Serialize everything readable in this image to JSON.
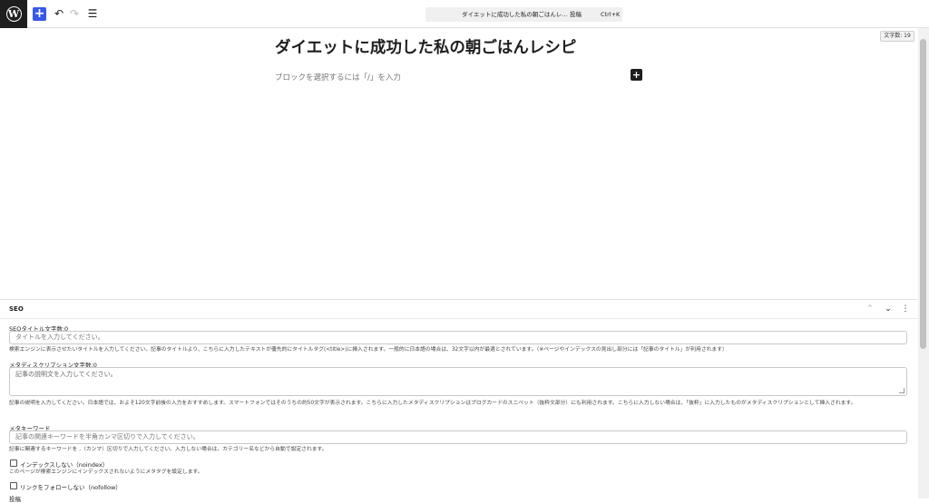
{
  "toolbar": {
    "logo_letter": "W",
    "add_label": "+",
    "undo_icon": "↶",
    "redo_icon": "↷",
    "list_icon": "☰",
    "command_bar": {
      "title": "ダイエットに成功した私の朝ごはんレ…",
      "type": "投稿",
      "shortcut": "Ctrl+K"
    }
  },
  "editor": {
    "post_title": "ダイエットに成功した私の朝ごはんレシピ",
    "block_placeholder": "ブロックを選択するには「/」を入力",
    "inline_add": "+",
    "char_count": "文字数: 19"
  },
  "seo": {
    "heading": "SEO",
    "collapse_up": "⌃",
    "collapse_down": "⌄",
    "more": "⋮",
    "title_field": {
      "label": "SEOタイトル文字数:0",
      "placeholder": "タイトルを入力してください。",
      "help": "検索エンジンに表示させたいタイトルを入力してください。記事のタイトルより、こちらに入力したテキストが優先的にタイトルタグ(<title>)に挿入されます。一般的に日本語の場合は、32文字以内が最適とされています。（※ページやインデックスの見出し部分には「記事のタイトル」が利用されます）"
    },
    "description_field": {
      "label": "メタディスクリプション文字数:0",
      "placeholder": "記事の説明文を入力してください。",
      "help": "記事の説明を入力してください。日本語では、およそ120文字前後の入力をおすすめします。スマートフォンではそのうちの約50文字が表示されます。こちらに入力したメタディスクリプションはブログカードのスニペット（抜粋文部分）にも利用されます。こちらに入力しない場合は、「抜粋」に入力したものがメタディスクリプションとして挿入されます。"
    },
    "keyword_field": {
      "label": "メタキーワード",
      "placeholder": "記事の関連キーワードを半角カンマ区切りで入力してください。",
      "help": "記事に関連するキーワードを ,（カンマ）区切りで入力してください。入力しない場合は、カテゴリー名などから自動で設定されます。"
    },
    "noindex": {
      "label": "インデックスしない（noindex）",
      "help": "このページが検索エンジンにインデックスされないようにメタタグを設定します。"
    },
    "nofollow": {
      "label": "リンクをフォローしない（nofollow）"
    },
    "cut_label": "投稿"
  }
}
